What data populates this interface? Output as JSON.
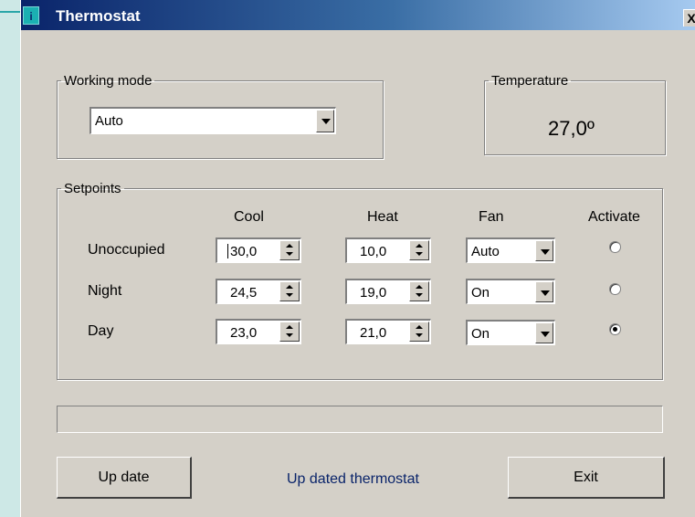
{
  "window": {
    "title": "Thermostat",
    "icon": "info-icon",
    "close_label": "X"
  },
  "working_mode": {
    "legend": "Working mode",
    "value": "Auto"
  },
  "temperature": {
    "legend": "Temperature",
    "value": "27,0º"
  },
  "setpoints": {
    "legend": "Setpoints",
    "headers": {
      "cool": "Cool",
      "heat": "Heat",
      "fan": "Fan",
      "activate": "Activate"
    },
    "rows": [
      {
        "label": "Unoccupied",
        "cool": "30,0",
        "heat": "10,0",
        "fan": "Auto",
        "active": false
      },
      {
        "label": "Night",
        "cool": "24,5",
        "heat": "19,0",
        "fan": "On",
        "active": false
      },
      {
        "label": "Day",
        "cool": "23,0",
        "heat": "21,0",
        "fan": "On",
        "active": true
      }
    ]
  },
  "progress": {
    "value": 0
  },
  "footer": {
    "update_label": "Up date",
    "status": "Up dated thermostat",
    "exit_label": "Exit"
  },
  "colors": {
    "title_start": "#0a246a",
    "title_end": "#a6caf0",
    "face": "#d4d0c8",
    "status_text": "#0a246a",
    "backdrop": "#cde8e6"
  }
}
